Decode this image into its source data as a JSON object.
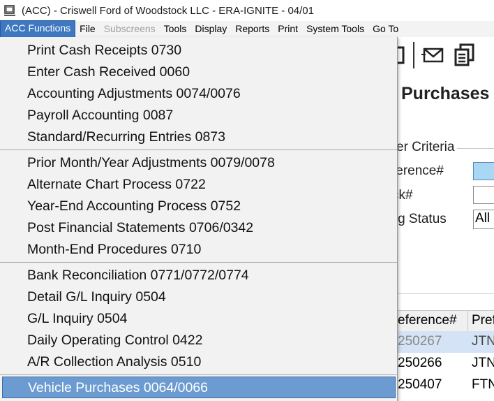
{
  "window": {
    "title": "(ACC) - Criswell Ford of Woodstock LLC - ERA-IGNITE - 04/01"
  },
  "menubar": {
    "items": [
      {
        "label": "ACC Functions"
      },
      {
        "label": "File"
      },
      {
        "label": "Subscreens"
      },
      {
        "label": "Tools"
      },
      {
        "label": "Display"
      },
      {
        "label": "Reports"
      },
      {
        "label": "Print"
      },
      {
        "label": "System Tools"
      },
      {
        "label": "Go To"
      }
    ]
  },
  "dropdown": {
    "groups": [
      [
        {
          "label": "Print Cash Receipts 0730"
        },
        {
          "label": "Enter Cash Received 0060"
        },
        {
          "label": "Accounting Adjustments 0074/0076"
        },
        {
          "label": "Payroll Accounting 0087"
        },
        {
          "label": "Standard/Recurring Entries 0873"
        }
      ],
      [
        {
          "label": "Prior Month/Year Adjustments 0079/0078"
        },
        {
          "label": "Alternate Chart Process 0722"
        },
        {
          "label": "Year-End Accounting Process 0752"
        },
        {
          "label": "Post Financial Statements 0706/0342"
        },
        {
          "label": "Month-End Procedures 0710"
        }
      ],
      [
        {
          "label": "Bank Reconciliation 0771/0772/0774"
        },
        {
          "label": "Detail G/L Inquiry 0504"
        },
        {
          "label": "G/L Inquiry 0504"
        },
        {
          "label": "Daily Operating Control 0422"
        },
        {
          "label": "A/R Collection Analysis 0510"
        }
      ],
      [
        {
          "label": "Vehicle Purchases 0064/0066"
        }
      ]
    ]
  },
  "background": {
    "heading": "Purchases",
    "criteria_title": "er Criteria",
    "criteria": {
      "ref_label": "ference#",
      "stock_label": "ck#",
      "status_label": "ting Status",
      "status_value": "All"
    },
    "grid": {
      "headers": [
        "eference#",
        "Pref"
      ],
      "rows": [
        [
          "250267",
          "JTN"
        ],
        [
          "250266",
          "JTN"
        ],
        [
          "250407",
          "FTN"
        ]
      ]
    }
  }
}
